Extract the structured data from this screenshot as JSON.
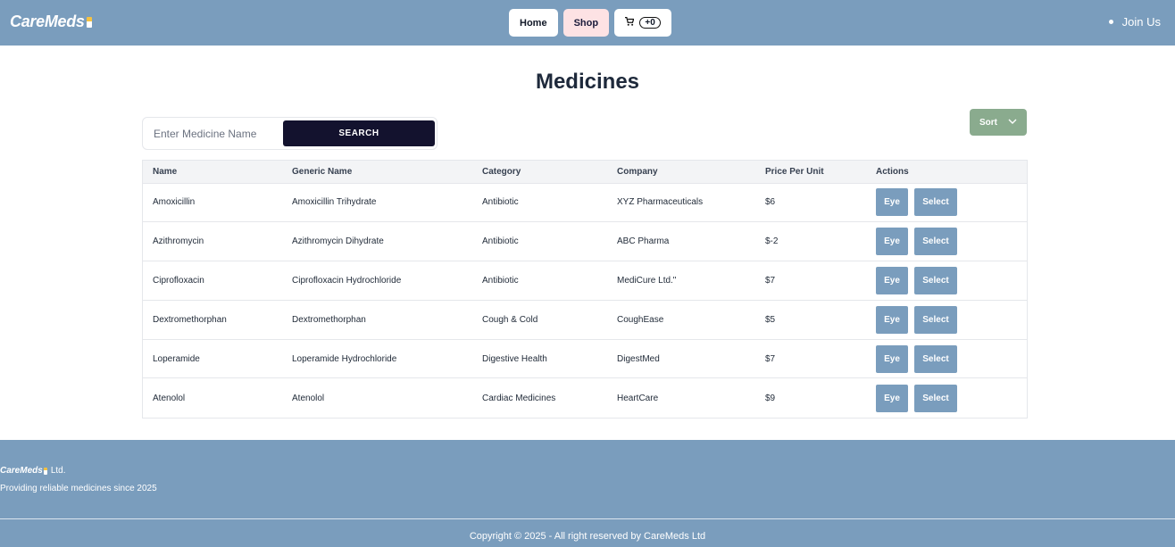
{
  "brand": {
    "name": "CareMeds"
  },
  "nav": {
    "home": "Home",
    "shop": "Shop",
    "cart_count": "+0"
  },
  "join": {
    "label": "Join Us"
  },
  "page": {
    "title": "Medicines"
  },
  "search": {
    "placeholder": "Enter Medicine Name",
    "button": "SEARCH"
  },
  "sort": {
    "label": "Sort"
  },
  "table": {
    "headers": [
      "Name",
      "Generic Name",
      "Category",
      "Company",
      "Price Per Unit",
      "Actions"
    ],
    "rows": [
      {
        "name": "Amoxicillin",
        "generic": "Amoxicillin Trihydrate",
        "category": "Antibiotic",
        "company": "XYZ Pharmaceuticals",
        "price": "$6"
      },
      {
        "name": "Azithromycin",
        "generic": "Azithromycin Dihydrate",
        "category": "Antibiotic",
        "company": "ABC Pharma",
        "price": "$-2"
      },
      {
        "name": "Ciprofloxacin",
        "generic": "Ciprofloxacin Hydrochloride",
        "category": "Antibiotic",
        "company": "MediCure Ltd.\"",
        "price": "$7"
      },
      {
        "name": "Dextromethorphan",
        "generic": "Dextromethorphan",
        "category": "Cough & Cold",
        "company": "CoughEase",
        "price": "$5"
      },
      {
        "name": "Loperamide",
        "generic": "Loperamide Hydrochloride",
        "category": "Digestive Health",
        "company": "DigestMed",
        "price": "$7"
      },
      {
        "name": "Atenolol",
        "generic": "Atenolol",
        "category": "Cardiac Medicines",
        "company": "HeartCare",
        "price": "$9"
      }
    ],
    "eye_label": "Eye",
    "select_label": "Select"
  },
  "footer": {
    "brand_name": "CareMeds",
    "brand_suffix": "Ltd.",
    "tagline": "Providing reliable medicines since 2025",
    "copyright": "Copyright © 2025 - All right reserved by CareMeds Ltd"
  },
  "colors": {
    "header_bg": "#7a9dbd",
    "search_btn": "#13122e",
    "sort_btn": "#8aab8e",
    "shop_bg": "#fde2e4"
  },
  "icons": {
    "cart": "cart-icon",
    "chevron": "chevron-down-icon",
    "pill": "pill-icon"
  }
}
